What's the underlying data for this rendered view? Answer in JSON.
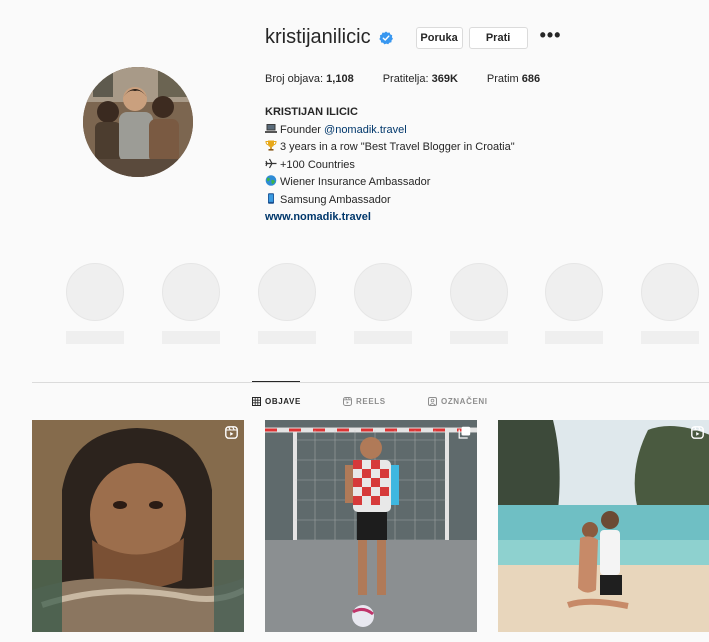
{
  "profile": {
    "username": "kristijanilicic",
    "message_label": "Poruka",
    "follow_label": "Prati",
    "more_label": "•••",
    "stats": {
      "posts_label": "Broj objava:",
      "posts_value": "1,108",
      "followers_label": "Pratitelja:",
      "followers_value": "369K",
      "following_label": "Pratim",
      "following_value": "686"
    },
    "bio": {
      "name": "KRISTIJAN ILICIC",
      "line1_text": "Founder ",
      "line1_mention": "@nomadik.travel",
      "line2": "3 years in a row \"Best Travel Blogger in Croatia\"",
      "line3": "+100 Countries",
      "line4": "Wiener Insurance Ambassador",
      "line5": "Samsung Ambassador",
      "website": "www.nomadik.travel"
    }
  },
  "tabs": [
    {
      "label": "OBJAVE",
      "icon": "grid-icon",
      "active": true
    },
    {
      "label": "REELS",
      "icon": "reels-icon",
      "active": false
    },
    {
      "label": "OZNAČENI",
      "icon": "tagged-icon",
      "active": false
    }
  ],
  "highlights_count": 7,
  "icons": {
    "verified": "verified-badge-icon",
    "line1": "laptop-icon",
    "line2": "trophy-icon",
    "line3": "airplane-icon",
    "line4": "globe-icon",
    "line5": "phone-icon"
  },
  "colors": {
    "verified_blue": "#3897f0",
    "link_blue": "#00376b",
    "placeholder_gray": "#efefef"
  }
}
